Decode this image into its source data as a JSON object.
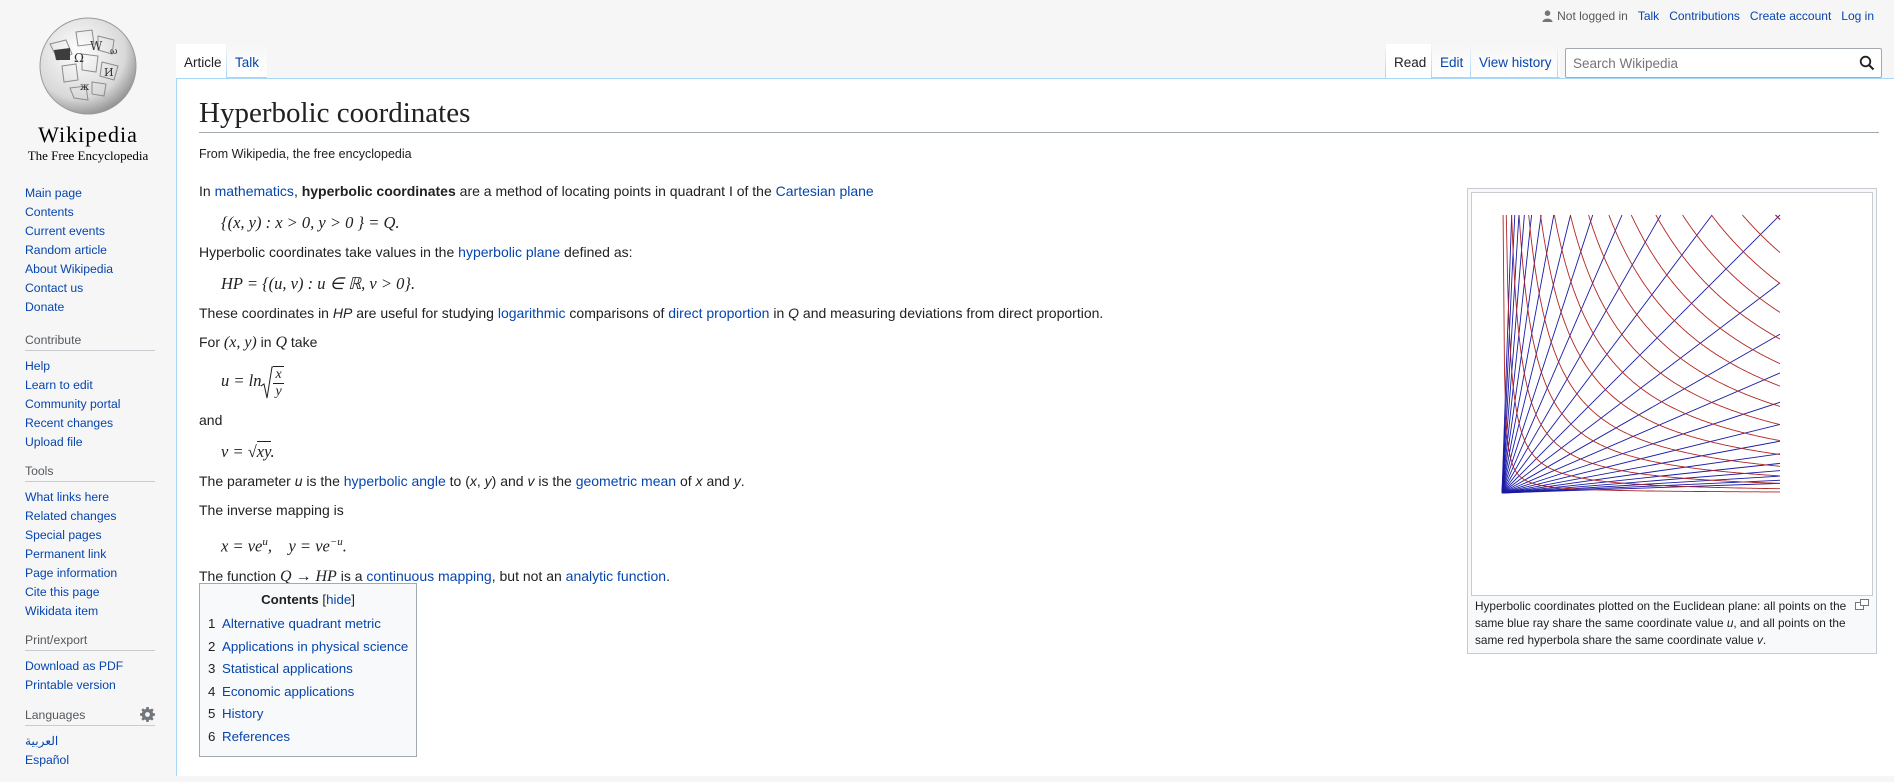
{
  "logo": {
    "wordmark": "Wikipedia",
    "tagline": "The Free Encyclopedia",
    "icon": "wikipedia-globe-icon"
  },
  "personal": {
    "not_logged_in": "Not logged in",
    "talk": "Talk",
    "contributions": "Contributions",
    "create_account": "Create account",
    "log_in": "Log in"
  },
  "tabs": {
    "article": "Article",
    "talk": "Talk",
    "read": "Read",
    "edit": "Edit",
    "view_history": "View history"
  },
  "search": {
    "placeholder": "Search Wikipedia",
    "icon": "search-icon"
  },
  "sidebar": {
    "nav": [
      "Main page",
      "Contents",
      "Current events",
      "Random article",
      "About Wikipedia",
      "Contact us",
      "Donate"
    ],
    "contribute": {
      "heading": "Contribute",
      "items": [
        "Help",
        "Learn to edit",
        "Community portal",
        "Recent changes",
        "Upload file"
      ]
    },
    "tools": {
      "heading": "Tools",
      "items": [
        "What links here",
        "Related changes",
        "Special pages",
        "Permanent link",
        "Page information",
        "Cite this page",
        "Wikidata item"
      ]
    },
    "print": {
      "heading": "Print/export",
      "items": [
        "Download as PDF",
        "Printable version"
      ]
    },
    "languages": {
      "heading": "Languages",
      "items": [
        "العربية",
        "Español"
      ],
      "icon": "gear-icon"
    }
  },
  "article": {
    "title": "Hyperbolic coordinates",
    "site_sub": "From Wikipedia, the free encyclopedia",
    "p1": {
      "pre": "In ",
      "link1": "mathematics",
      "comma": ", ",
      "bold": "hyperbolic coordinates",
      "mid": " are a method of locating points in quadrant I of the ",
      "link2": "Cartesian plane"
    },
    "eq1": "{(x, y) : x > 0, y > 0 } = Q.",
    "p2": {
      "pre": "Hyperbolic coordinates take values in the ",
      "link": "hyperbolic plane",
      "post": " defined as:"
    },
    "eq2": "HP = {(u, v) : u ∈ ℝ, v > 0}.",
    "p3": {
      "pre": "These coordinates in ",
      "hp": "HP",
      "mid1": " are useful for studying ",
      "link1": "logarithmic",
      "mid2": " comparisons of ",
      "link2": "direct proportion",
      "mid3": " in ",
      "q": "Q",
      "post": " and measuring deviations from direct proportion."
    },
    "p4": {
      "pre": "For ",
      "xy": "(x, y)",
      "mid": " in ",
      "q": "Q",
      "post": " take"
    },
    "eq_u": {
      "lhs": "u = ln",
      "num": "x",
      "den": "y"
    },
    "p_and": "and",
    "eq_v": {
      "lhs": "v = ",
      "rad": "xy",
      "end": "."
    },
    "p5": {
      "pre": "The parameter ",
      "u": "u",
      "mid1": " is the ",
      "link1": "hyperbolic angle",
      "mid2": " to (",
      "x": "x",
      "sep": ", ",
      "y": "y",
      "mid3": ") and ",
      "v": "v",
      "mid4": " is the ",
      "link2": "geometric mean",
      "mid5": " of ",
      "x2": "x",
      "and": " and ",
      "y2": "y",
      "end": "."
    },
    "p6": "The inverse mapping is",
    "eq_inv": {
      "x": "x = ve",
      "sup1": "u",
      "y": ",    y = ve",
      "sup2": "−u",
      "end": "."
    },
    "p7": {
      "pre": "The function ",
      "math": "Q → HP",
      "mid1": " is a ",
      "link1": "continuous mapping",
      "mid2": ", but not an ",
      "link2": "analytic function",
      "end": "."
    }
  },
  "toc": {
    "title": "Contents",
    "hide": "hide",
    "items": [
      {
        "num": "1",
        "label": "Alternative quadrant metric"
      },
      {
        "num": "2",
        "label": "Applications in physical science"
      },
      {
        "num": "3",
        "label": "Statistical applications"
      },
      {
        "num": "4",
        "label": "Economic applications"
      },
      {
        "num": "5",
        "label": "History"
      },
      {
        "num": "6",
        "label": "References"
      }
    ]
  },
  "figure": {
    "caption": {
      "pre": "Hyperbolic coordinates plotted on the Euclidean plane: all points on the same blue ray share the same coordinate value ",
      "u": "u",
      "mid": ", and all points on the same red hyperbola share the same coordinate value ",
      "v": "v",
      "end": "."
    },
    "colors": {
      "rays": "#1a1aa6",
      "hyperbolas": "#b32424"
    }
  }
}
